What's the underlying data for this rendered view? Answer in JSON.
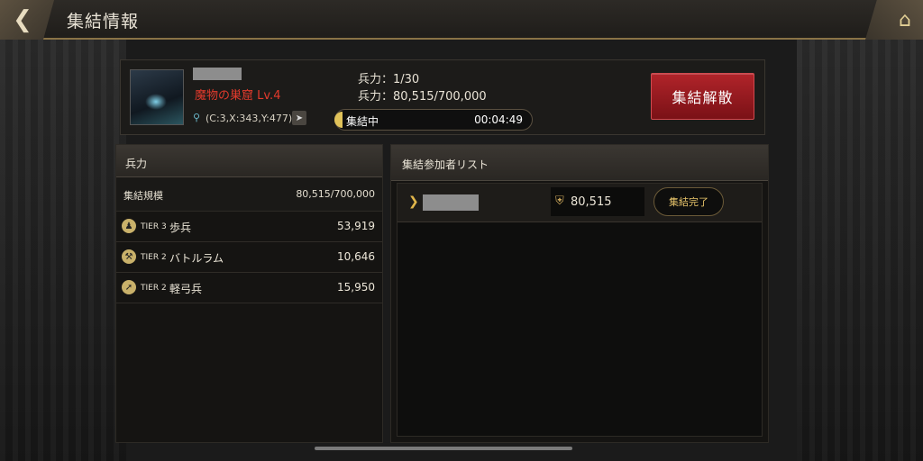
{
  "header": {
    "title": "集結情報"
  },
  "rally": {
    "monster": "魔物の巣窟 Lv.4",
    "coords": "(C:3,X:343,Y:477)",
    "troops_count": "兵力：1/30",
    "power": "兵力：80,515/700,000",
    "timer_label": "集結中",
    "timer_value": "00:04:49",
    "disband_label": "集結解散"
  },
  "left_panel": {
    "title": "兵力",
    "scale_label": "集結規模",
    "scale_value": "80,515/700,000",
    "troops": [
      {
        "tier": "TIER 3",
        "name": "歩兵",
        "value": "53,919",
        "icon": "infantry-icon"
      },
      {
        "tier": "TIER 2",
        "name": "バトルラム",
        "value": "10,646",
        "icon": "battering-ram-icon"
      },
      {
        "tier": "TIER 2",
        "name": "軽弓兵",
        "value": "15,950",
        "icon": "archer-icon"
      }
    ]
  },
  "right_panel": {
    "title": "集結参加者リスト",
    "members": [
      {
        "power": "80,515",
        "status": "集結完了"
      }
    ]
  },
  "colors": {
    "accent": "#e1b64a",
    "danger": "#b1242a",
    "monster_text": "#e23a2c"
  }
}
